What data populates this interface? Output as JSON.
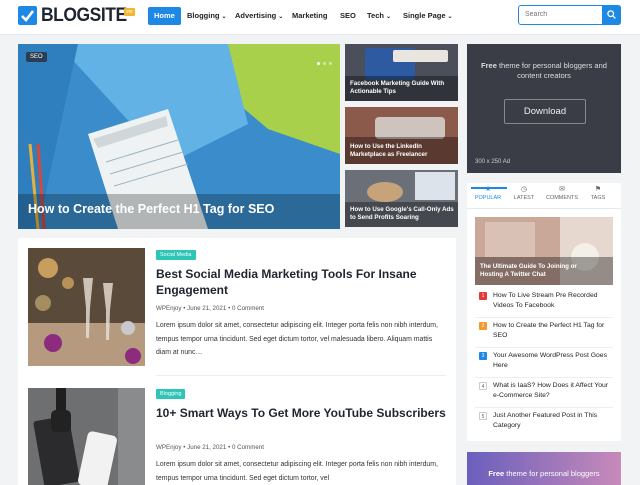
{
  "header": {
    "logo_text": "BLOGSITE",
    "logo_badge": "ver",
    "nav": [
      {
        "label": "Home",
        "active": true,
        "dropdown": false
      },
      {
        "label": "Blogging",
        "active": false,
        "dropdown": true
      },
      {
        "label": "Advertising",
        "active": false,
        "dropdown": true
      },
      {
        "label": "Marketing",
        "active": false,
        "dropdown": false
      },
      {
        "label": "SEO",
        "active": false,
        "dropdown": false
      },
      {
        "label": "Tech",
        "active": false,
        "dropdown": true
      },
      {
        "label": "Single Page",
        "active": false,
        "dropdown": true
      }
    ],
    "search_placeholder": "Search",
    "accent": "#1e88e5"
  },
  "hero": {
    "tag": "SEO",
    "title": "How to Create the Perfect H1 Tag for SEO"
  },
  "side_cards": [
    {
      "title": "Facebook Marketing Guide With Actionable Tips"
    },
    {
      "title": "How to Use the LinkedIn Marketplace as Freelancer"
    },
    {
      "title": "How to Use Google's Call-Only Ads to Send Profits Soaring"
    }
  ],
  "ad": {
    "text_bold": "Free",
    "text": " theme for personal bloggers and content creators",
    "button": "Download",
    "size": "300 x 250 Ad"
  },
  "tabs": [
    {
      "label": "POPULAR",
      "icon": "star-icon",
      "active": true
    },
    {
      "label": "LATEST",
      "icon": "clock-icon",
      "active": false
    },
    {
      "label": "COMMENTS",
      "icon": "comments-icon",
      "active": false
    },
    {
      "label": "TAGS",
      "icon": "tag-icon",
      "active": false
    }
  ],
  "popular": {
    "featured_title": "The Ultimate Guide To Joining or Hosting A Twitter Chat",
    "items": [
      {
        "num": "1",
        "title": "How To Live Stream Pre Recorded Videos To Facebook",
        "color": "#e53935"
      },
      {
        "num": "2",
        "title": "How to Create the Perfect H1 Tag for SEO",
        "color": "#f29a2e"
      },
      {
        "num": "3",
        "title": "Your Awesome WordPress Post Goes Here",
        "color": "#1e88e5"
      },
      {
        "num": "4",
        "title": "What is IaaS? How Does it Affect Your e-Commerce Site?",
        "color": "#ffffff"
      },
      {
        "num": "5",
        "title": "Just Another Featured Post in This Category",
        "color": "#ffffff"
      }
    ]
  },
  "ad2": {
    "text_bold": "Free",
    "text": " theme for personal bloggers"
  },
  "posts": [
    {
      "category": "Social Media",
      "title": "Best Social Media Marketing Tools For Insane Engagement",
      "author": "WPEnjoy",
      "date": "June 21, 2021",
      "comments": "0 Comment",
      "excerpt": "Lorem ipsum dolor sit amet, consectetur adipiscing elit. Integer porta felis non nibh interdum, tempus tempor urna tincidunt. Sed eget dictum tortor, vel malesuada libero. Aliquam mattis diam at nunc…"
    },
    {
      "category": "Blogging",
      "title": "10+ Smart Ways To Get More YouTube Subscribers",
      "author": "WPEnjoy",
      "date": "June 21, 2021",
      "comments": "0 Comment",
      "excerpt": "Lorem ipsum dolor sit amet, consectetur adipiscing elit. Integer porta felis non nibh interdum, tempus tempor urna tincidunt. Sed eget dictum tortor, vel"
    }
  ],
  "meta_sep": "•"
}
